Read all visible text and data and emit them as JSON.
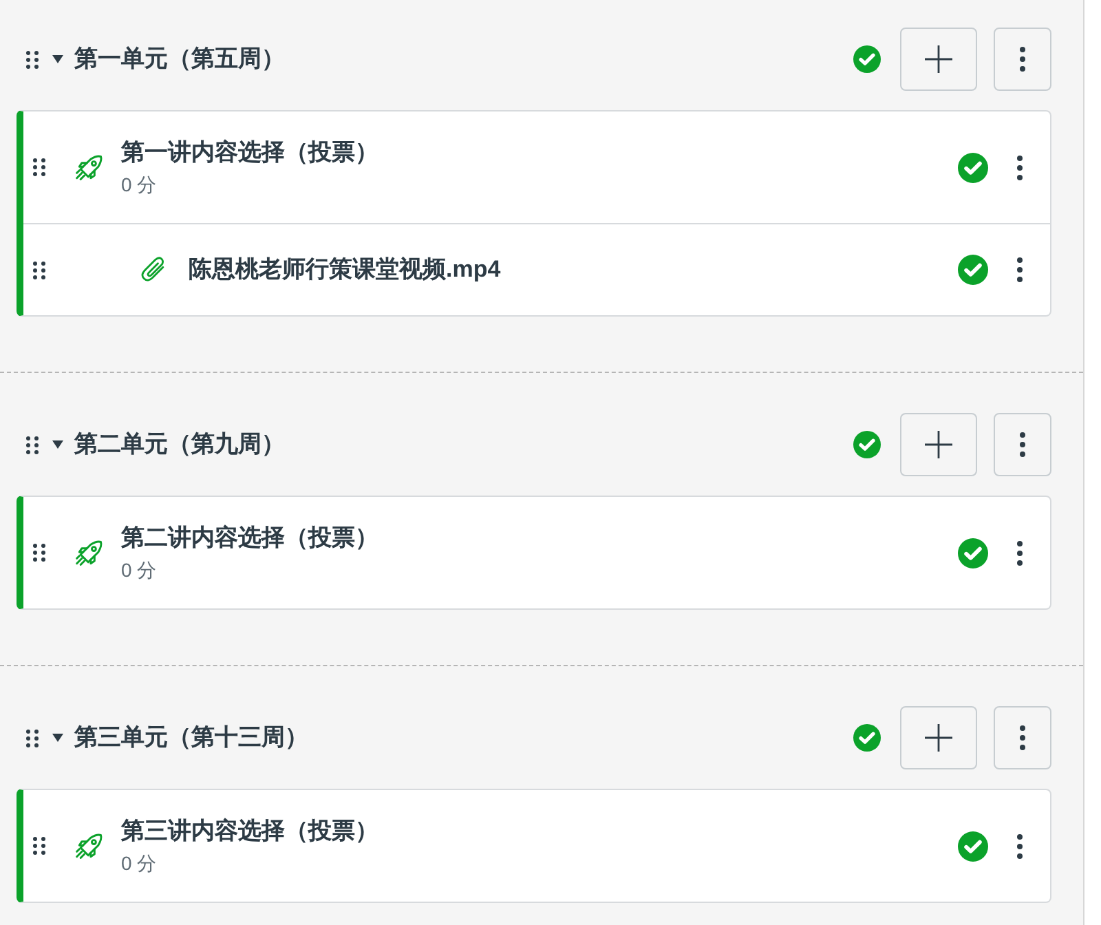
{
  "modules": [
    {
      "title": "第一单元（第五周）",
      "expanded": true,
      "published": true,
      "items": [
        {
          "kind": "quiz",
          "title": "第一讲内容选择（投票）",
          "points": "0 分",
          "published": true
        },
        {
          "kind": "attachment",
          "title": "陈恩桃老师行策课堂视频.mp4",
          "published": true
        }
      ]
    },
    {
      "title": "第二单元（第九周）",
      "expanded": true,
      "published": true,
      "items": [
        {
          "kind": "quiz",
          "title": "第二讲内容选择（投票）",
          "points": "0 分",
          "published": true
        }
      ]
    },
    {
      "title": "第三单元（第十三周）",
      "expanded": true,
      "published": true,
      "items": [
        {
          "kind": "quiz",
          "title": "第三讲内容选择（投票）",
          "points": "0 分",
          "published": true
        }
      ]
    }
  ]
}
